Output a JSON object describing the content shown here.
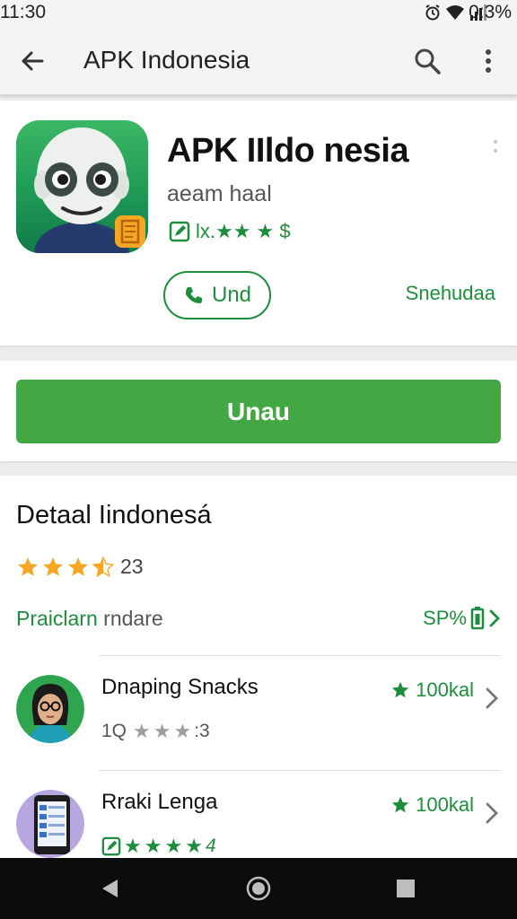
{
  "status_bar": {
    "time": "11:30",
    "battery_percent": "0:3%"
  },
  "toolbar": {
    "title": "APK Indonesia"
  },
  "app": {
    "name": "APK IIldo nesia",
    "developer": "aeam haal",
    "rating_text": "lx.★★ ★ $",
    "pill_button_label": "Und",
    "right_link_label": "Snehudaa"
  },
  "install": {
    "button_label": "Unau"
  },
  "details": {
    "title": "Detaal Iindonesá",
    "rating_value": "23",
    "rating_stars": 3.5,
    "preview_label": "Praiclarn ",
    "preview_label_dim": "rndare",
    "preview_link": "SP%"
  },
  "related": [
    {
      "title": "Dnaping Snacks",
      "meta_prefix": "1Q",
      "meta_suffix": ":3",
      "score": "100kal"
    },
    {
      "title": "Rraki Lenga",
      "meta_suffix": "4",
      "score": "100kal"
    }
  ],
  "colors": {
    "accent": "#1e8e3e",
    "install": "#43a843",
    "star": "#f5a623",
    "icon_bg": "#1f9a55"
  }
}
